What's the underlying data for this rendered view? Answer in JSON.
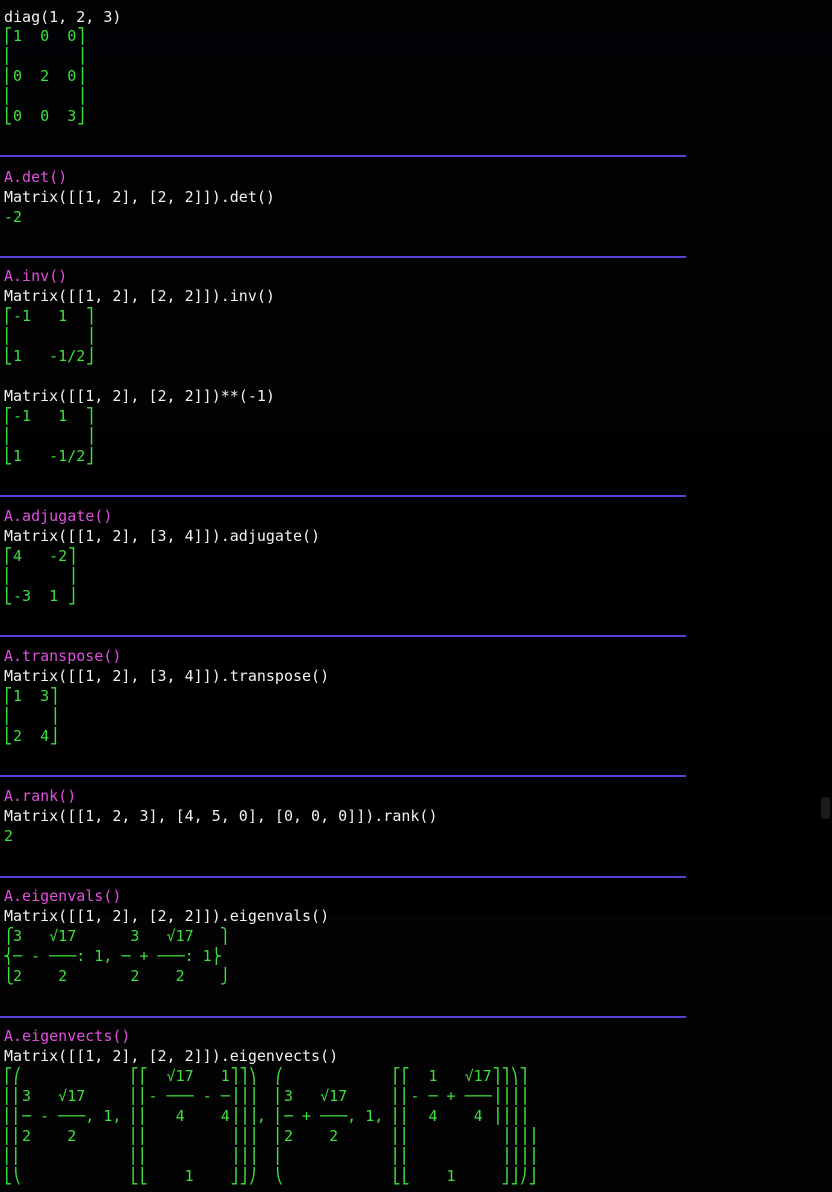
{
  "lines": {
    "l01": "diag(1, 2, 3)",
    "l02": "⎡1  0  0⎤",
    "l03": "⎢       ⎥",
    "l04": "⎢0  2  0⎥",
    "l05": "⎢       ⎥",
    "l06": "⎣0  0  3⎦",
    "l07": "A.det()",
    "l08": "Matrix([[1, 2], [2, 2]]).det()",
    "l09": "-2",
    "l10": "A.inv()",
    "l11": "Matrix([[1, 2], [2, 2]]).inv()",
    "l12": "⎡-1   1  ⎤",
    "l13": "⎢        ⎥",
    "l14": "⎣1   -1/2⎦",
    "l15": "Matrix([[1, 2], [2, 2]])**(-1)",
    "l16": "⎡-1   1  ⎤",
    "l17": "⎢        ⎥",
    "l18": "⎣1   -1/2⎦",
    "l19": "A.adjugate()",
    "l20": "Matrix([[1, 2], [3, 4]]).adjugate()",
    "l21": "⎡4   -2⎤",
    "l22": "⎢      ⎥",
    "l23": "⎣-3  1 ⎦",
    "l24": "A.transpose()",
    "l25": "Matrix([[1, 2], [3, 4]]).transpose()",
    "l26": "⎡1  3⎤",
    "l27": "⎢    ⎥",
    "l28": "⎣2  4⎦",
    "l29": "A.rank()",
    "l30": "Matrix([[1, 2, 3], [4, 5, 0], [0, 0, 0]]).rank()",
    "l31": "2",
    "l32": "A.eigenvals()",
    "l33": "Matrix([[1, 2], [2, 2]]).eigenvals()",
    "l34": "⎧3   √17      3   √17   ⎫",
    "l35": "⎨─ - ───: 1, ─ + ───: 1⎬",
    "l36": "⎩2    2       2    2    ⎭",
    "l37": "A.eigenvects()",
    "l38": "Matrix([[1, 2], [2, 2]]).eigenvects()",
    "l39": "⎡⎛            ⎡⎡  √17   1⎤⎤⎞  ⎛            ⎡⎡  1   √17⎤⎤⎞⎤",
    "l40": "⎢⎜3   √17     ⎢⎢- ─── - ─⎥⎥⎟  ⎜3   √17     ⎢⎢- ─ + ───⎥⎥⎟⎥",
    "l41": "⎢⎜─ - ───, 1, ⎢⎢   4    4⎥⎥⎟, ⎜─ + ───, 1, ⎢⎢  4    4 ⎥⎥⎟⎥",
    "l42": "⎢⎜2    2      ⎢⎢         ⎥⎥⎟  ⎜2    2      ⎢⎢          ⎥⎥⎟⎥",
    "l43": "⎢⎜            ⎢⎢         ⎥⎥⎟  ⎜            ⎢⎢          ⎥⎥⎟⎥",
    "l44": "⎣⎝            ⎣⎣    1    ⎦⎦⎠  ⎝            ⎣⎣    1     ⎦⎦⎠⎦"
  }
}
